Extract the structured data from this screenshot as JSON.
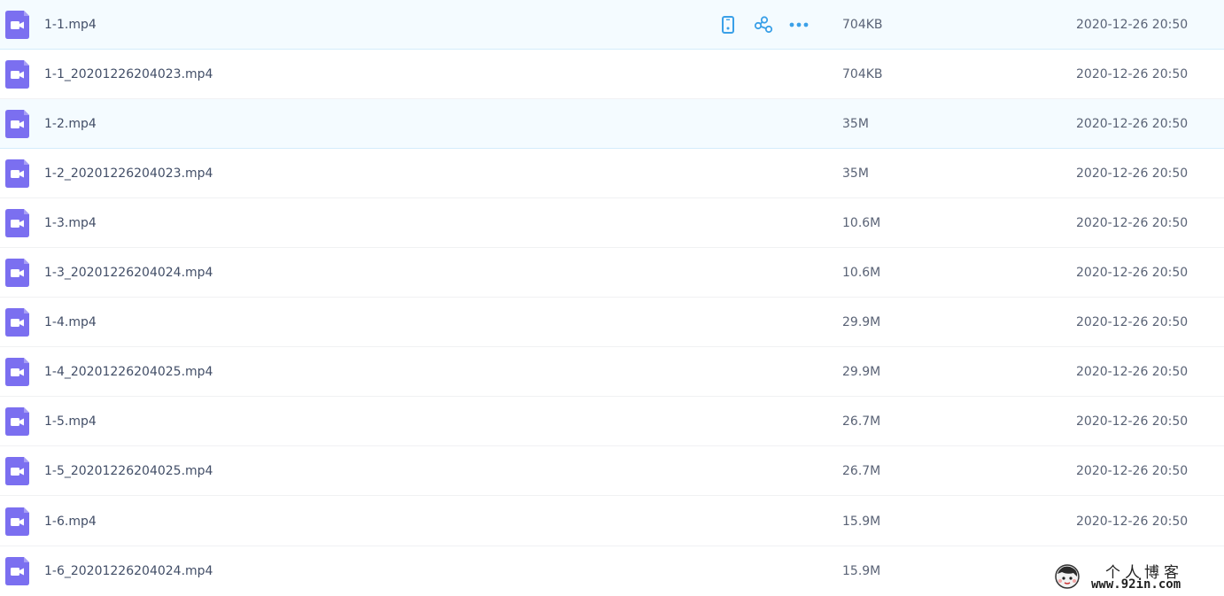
{
  "files": [
    {
      "name": "1-1.mp4",
      "size": "704KB",
      "date": "2020-12-26 20:50",
      "hovered": true,
      "icon": "video-file-icon"
    },
    {
      "name": "1-1_20201226204023.mp4",
      "size": "704KB",
      "date": "2020-12-26 20:50",
      "icon": "video-file-icon"
    },
    {
      "name": "1-2.mp4",
      "size": "35M",
      "date": "2020-12-26 20:50",
      "selected": true,
      "icon": "video-file-icon"
    },
    {
      "name": "1-2_20201226204023.mp4",
      "size": "35M",
      "date": "2020-12-26 20:50",
      "icon": "video-file-icon"
    },
    {
      "name": "1-3.mp4",
      "size": "10.6M",
      "date": "2020-12-26 20:50",
      "icon": "video-file-icon"
    },
    {
      "name": "1-3_20201226204024.mp4",
      "size": "10.6M",
      "date": "2020-12-26 20:50",
      "icon": "video-file-icon"
    },
    {
      "name": "1-4.mp4",
      "size": "29.9M",
      "date": "2020-12-26 20:50",
      "icon": "video-file-icon"
    },
    {
      "name": "1-4_20201226204025.mp4",
      "size": "29.9M",
      "date": "2020-12-26 20:50",
      "icon": "video-file-icon"
    },
    {
      "name": "1-5.mp4",
      "size": "26.7M",
      "date": "2020-12-26 20:50",
      "icon": "video-file-icon"
    },
    {
      "name": "1-5_20201226204025.mp4",
      "size": "26.7M",
      "date": "2020-12-26 20:50",
      "icon": "video-file-icon"
    },
    {
      "name": "1-6.mp4",
      "size": "15.9M",
      "date": "2020-12-26 20:50",
      "icon": "video-file-icon"
    },
    {
      "name": "1-6_20201226204024.mp4",
      "size": "15.9M",
      "date": "",
      "icon": "video-file-icon"
    }
  ],
  "row_actions": [
    {
      "name": "phone-icon"
    },
    {
      "name": "share-icon"
    },
    {
      "name": "more-icon"
    }
  ],
  "watermark": {
    "title": "个人博客",
    "url": "www.92in.com"
  },
  "colors": {
    "icon_purple": "#7b6ff0",
    "action_blue": "#3aa0e8",
    "hover_bg": "#f4fbff"
  }
}
